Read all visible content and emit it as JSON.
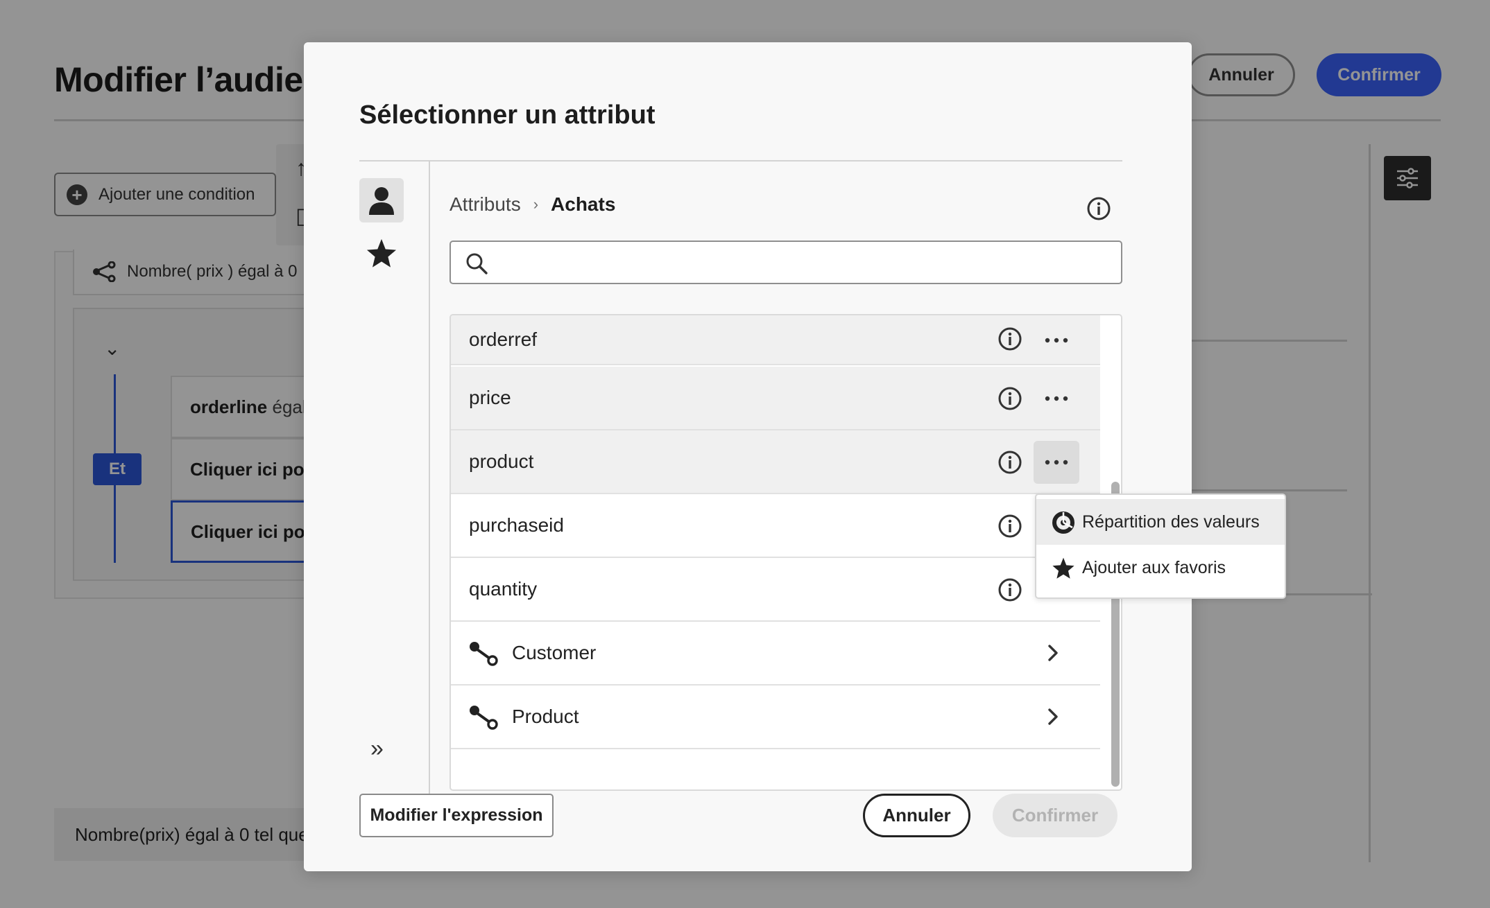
{
  "background": {
    "title": "Modifier l’audience",
    "cancel_label": "Annuler",
    "confirm_label": "Confirmer",
    "add_condition_label": "Ajouter une condition",
    "condition_text": "Nombre( prix ) égal à 0",
    "group_operator": "Et",
    "rows": [
      {
        "bold": "orderline",
        "light": "égal"
      },
      {
        "bold": "Cliquer ici pour",
        "light": ""
      },
      {
        "bold": "Cliquer ici pour",
        "light": ""
      }
    ],
    "footer_text": "Nombre(prix) égal à 0 tel que"
  },
  "dialog": {
    "title": "Sélectionner un attribut",
    "breadcrumb": {
      "root": "Attributs",
      "separator": "›",
      "current": "Achats"
    },
    "search": {
      "value": "",
      "placeholder": ""
    },
    "attributes": [
      {
        "label": "orderref"
      },
      {
        "label": "price"
      },
      {
        "label": "product"
      },
      {
        "label": "purchaseid"
      },
      {
        "label": "quantity"
      }
    ],
    "links": [
      {
        "label": "Customer"
      },
      {
        "label": "Product"
      }
    ],
    "context_menu": {
      "items": [
        {
          "label": "Répartition des valeurs",
          "icon": "value-distribution-icon"
        },
        {
          "label": "Ajouter aux favoris",
          "icon": "star-icon"
        }
      ]
    },
    "rail": {
      "expand_label": "»"
    },
    "footer": {
      "edit_expression_label": "Modifier l'expression",
      "cancel_label": "Annuler",
      "confirm_label": "Confirmer"
    }
  }
}
